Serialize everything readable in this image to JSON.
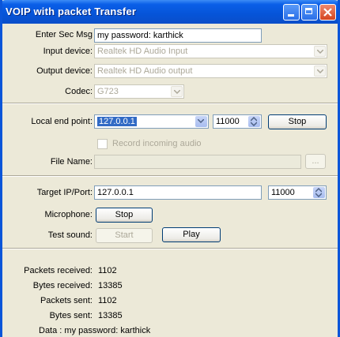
{
  "window": {
    "title": "VOIP with packet Transfer"
  },
  "form": {
    "enter_sec_msg_label": "Enter Sec Msg",
    "enter_sec_msg_value": "my password: karthick",
    "input_device_label": "Input device:",
    "input_device_value": "Realtek HD Audio Input",
    "output_device_label": "Output device:",
    "output_device_value": "Realtek HD Audio output",
    "codec_label": "Codec:",
    "codec_value": "G723",
    "local_end_point_label": "Local end point:",
    "local_end_point_value": "127.0.0.1",
    "local_port_value": "11000",
    "stop_local_label": "Stop",
    "record_label": "Record incoming audio",
    "file_name_label": "File Name:",
    "browse_label": "...",
    "target_label": "Target IP/Port:",
    "target_ip_value": "127.0.0.1",
    "target_port_value": "11000",
    "microphone_label": "Microphone:",
    "microphone_button": "Stop",
    "test_sound_label": "Test sound:",
    "start_button": "Start",
    "play_button": "Play"
  },
  "stats": {
    "packets_received_label": "Packets received:",
    "packets_received_value": "1102",
    "bytes_received_label": "Bytes received:",
    "bytes_received_value": "13385",
    "packets_sent_label": "Packets sent:",
    "packets_sent_value": "1102",
    "bytes_sent_label": "Bytes sent:",
    "bytes_sent_value": "13385",
    "data_text": "Data : my password: karthick"
  },
  "colors": {
    "titlebar": "#0654d8",
    "frame": "#0a55d9",
    "face": "#ece9d8",
    "selection": "#316ac5"
  }
}
